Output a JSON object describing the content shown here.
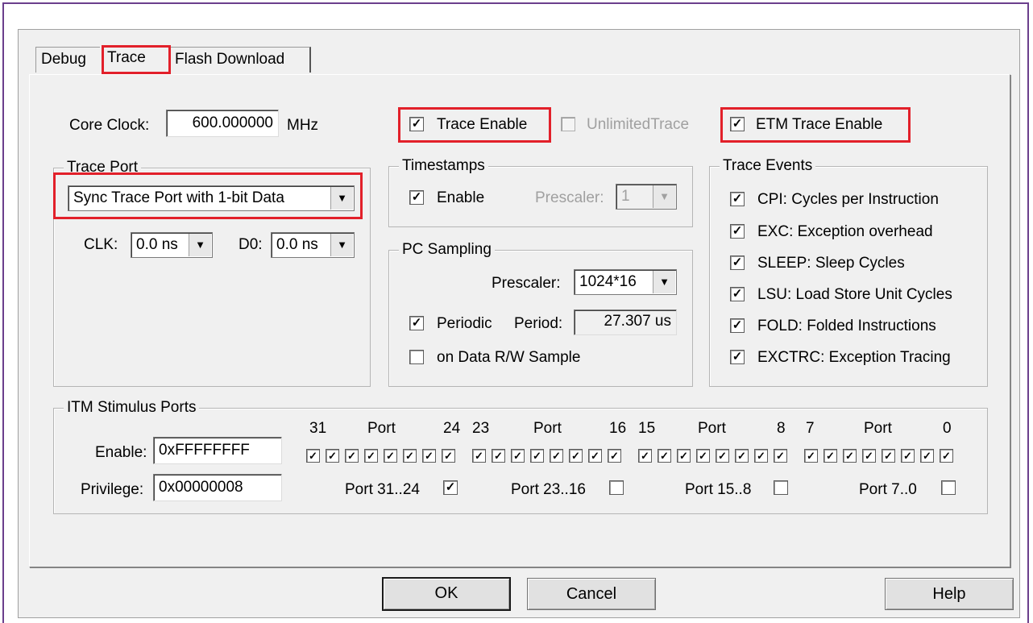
{
  "tabs": [
    {
      "label": "Debug"
    },
    {
      "label": "Trace",
      "active": true
    },
    {
      "label": "Flash Download"
    }
  ],
  "core_clock": {
    "label": "Core Clock:",
    "value": "600.000000",
    "unit": "MHz"
  },
  "trace_enable": {
    "label": "Trace Enable",
    "checked": true
  },
  "unlimited_trace": {
    "label": "UnlimitedTrace",
    "checked": false,
    "disabled": true
  },
  "etm_trace_enable": {
    "label": "ETM Trace Enable",
    "checked": true
  },
  "trace_port": {
    "title": "Trace Port",
    "selected": "Sync Trace Port with 1-bit Data",
    "clk_label": "CLK:",
    "clk_value": "0.0 ns",
    "d0_label": "D0:",
    "d0_value": "0.0 ns"
  },
  "timestamps": {
    "title": "Timestamps",
    "enable_label": "Enable",
    "enable_checked": true,
    "prescaler_label": "Prescaler:",
    "prescaler_value": "1"
  },
  "pc_sampling": {
    "title": "PC Sampling",
    "prescaler_label": "Prescaler:",
    "prescaler_value": "1024*16",
    "periodic_label": "Periodic",
    "periodic_checked": true,
    "period_label": "Period:",
    "period_value": "27.307 us",
    "data_rw_label": "on Data R/W Sample",
    "data_rw_checked": false
  },
  "trace_events": {
    "title": "Trace Events",
    "items": [
      {
        "label": "CPI: Cycles per Instruction",
        "checked": true
      },
      {
        "label": "EXC: Exception overhead",
        "checked": true
      },
      {
        "label": "SLEEP: Sleep Cycles",
        "checked": true
      },
      {
        "label": "LSU: Load Store Unit Cycles",
        "checked": true
      },
      {
        "label": "FOLD: Folded Instructions",
        "checked": true
      },
      {
        "label": "EXCTRC: Exception Tracing",
        "checked": true
      }
    ]
  },
  "itm": {
    "title": "ITM Stimulus Ports",
    "enable_label": "Enable:",
    "enable_value": "0xFFFFFFFF",
    "privilege_label": "Privilege:",
    "privilege_value": "0x00000008",
    "port_word": "Port",
    "groups": [
      {
        "hi": "31",
        "lo": "24",
        "priv_label": "Port 31..24",
        "priv_checked": true
      },
      {
        "hi": "23",
        "lo": "16",
        "priv_label": "Port 23..16",
        "priv_checked": false
      },
      {
        "hi": "15",
        "lo": "8",
        "priv_label": "Port 15..8",
        "priv_checked": false
      },
      {
        "hi": "7",
        "lo": "0",
        "priv_label": "Port 7..0",
        "priv_checked": false
      }
    ]
  },
  "buttons": {
    "ok": "OK",
    "cancel": "Cancel",
    "help": "Help"
  },
  "check_mark": "✓",
  "arrow_glyph": "▼",
  "colors": {
    "highlight": "#e2202a",
    "frame": "#6b3f8c",
    "dialog_bg": "#f0f0f0"
  }
}
